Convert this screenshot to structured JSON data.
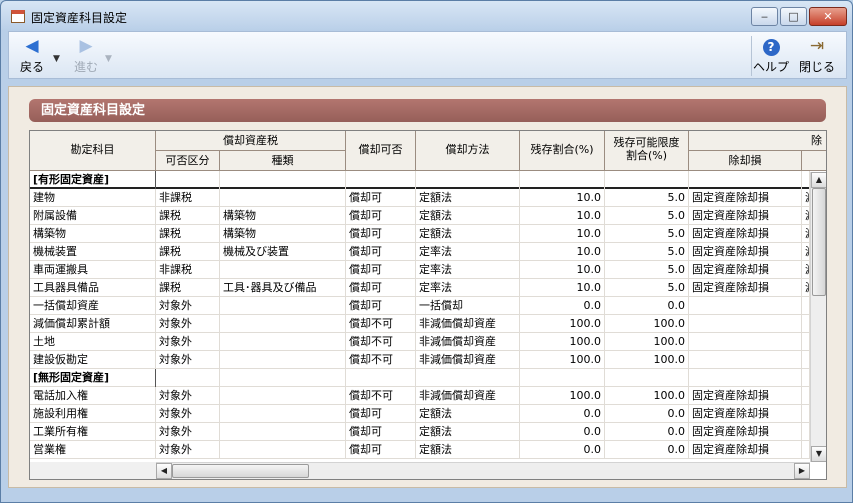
{
  "window": {
    "title": "固定資産科目設定",
    "min": "‒",
    "max": "□",
    "close": "✕"
  },
  "toolbar": {
    "back_label": "戻る",
    "forward_label": "進む",
    "help_label": "ヘルプ",
    "close_label": "閉じる",
    "back_icon": "◀",
    "forward_icon": "▶",
    "help_icon": "?",
    "close_icon": "⇥"
  },
  "section_title": "固定資産科目設定",
  "grid": {
    "headers": {
      "account": "勘定科目",
      "depreciable_tax": "償却資産税",
      "taxable": "可否区分",
      "kind": "種類",
      "depreciable": "償却可否",
      "method": "償却方法",
      "residual": "残存割合(%)",
      "residual_limit_1": "残存可能限度",
      "residual_limit_2": "割合(%)",
      "disposal_group": "除",
      "disposal_loss": "除却損"
    },
    "rows": [
      {
        "type": "category",
        "account": "[有形固定資産]"
      },
      {
        "account": "建物",
        "taxable": "非課税",
        "kind": "",
        "depreciable": "償却可",
        "method": "定額法",
        "residual": "10.0",
        "limit": "5.0",
        "disposal": "固定資産除却損",
        "extra": "減"
      },
      {
        "account": "附属設備",
        "taxable": "課税",
        "kind": "構築物",
        "depreciable": "償却可",
        "method": "定額法",
        "residual": "10.0",
        "limit": "5.0",
        "disposal": "固定資産除却損",
        "extra": "減"
      },
      {
        "account": "構築物",
        "taxable": "課税",
        "kind": "構築物",
        "depreciable": "償却可",
        "method": "定額法",
        "residual": "10.0",
        "limit": "5.0",
        "disposal": "固定資産除却損",
        "extra": "減"
      },
      {
        "account": "機械装置",
        "taxable": "課税",
        "kind": "機械及び装置",
        "depreciable": "償却可",
        "method": "定率法",
        "residual": "10.0",
        "limit": "5.0",
        "disposal": "固定資産除却損",
        "extra": "減"
      },
      {
        "account": "車両運搬具",
        "taxable": "非課税",
        "kind": "",
        "depreciable": "償却可",
        "method": "定率法",
        "residual": "10.0",
        "limit": "5.0",
        "disposal": "固定資産除却損",
        "extra": "減"
      },
      {
        "account": "工具器具備品",
        "taxable": "課税",
        "kind": "工具･器具及び備品",
        "depreciable": "償却可",
        "method": "定率法",
        "residual": "10.0",
        "limit": "5.0",
        "disposal": "固定資産除却損",
        "extra": "減"
      },
      {
        "account": "一括償却資産",
        "taxable": "対象外",
        "kind": "",
        "depreciable": "償却可",
        "method": "一括償却",
        "residual": "0.0",
        "limit": "0.0",
        "disposal": "",
        "extra": ""
      },
      {
        "account": "減価償却累計額",
        "taxable": "対象外",
        "kind": "",
        "depreciable": "償却不可",
        "method": "非減価償却資産",
        "residual": "100.0",
        "limit": "100.0",
        "disposal": "",
        "extra": ""
      },
      {
        "account": "土地",
        "taxable": "対象外",
        "kind": "",
        "depreciable": "償却不可",
        "method": "非減価償却資産",
        "residual": "100.0",
        "limit": "100.0",
        "disposal": "",
        "extra": ""
      },
      {
        "account": "建設仮勘定",
        "taxable": "対象外",
        "kind": "",
        "depreciable": "償却不可",
        "method": "非減価償却資産",
        "residual": "100.0",
        "limit": "100.0",
        "disposal": "",
        "extra": ""
      },
      {
        "type": "category",
        "account": "[無形固定資産]"
      },
      {
        "account": "電話加入権",
        "taxable": "対象外",
        "kind": "",
        "depreciable": "償却不可",
        "method": "非減価償却資産",
        "residual": "100.0",
        "limit": "100.0",
        "disposal": "固定資産除却損",
        "extra": ""
      },
      {
        "account": "施設利用権",
        "taxable": "対象外",
        "kind": "",
        "depreciable": "償却可",
        "method": "定額法",
        "residual": "0.0",
        "limit": "0.0",
        "disposal": "固定資産除却損",
        "extra": ""
      },
      {
        "account": "工業所有権",
        "taxable": "対象外",
        "kind": "",
        "depreciable": "償却可",
        "method": "定額法",
        "residual": "0.0",
        "limit": "0.0",
        "disposal": "固定資産除却損",
        "extra": ""
      },
      {
        "account": "営業権",
        "taxable": "対象外",
        "kind": "",
        "depreciable": "償却可",
        "method": "定額法",
        "residual": "0.0",
        "limit": "0.0",
        "disposal": "固定資産除却損",
        "extra": ""
      }
    ]
  },
  "scroll": {
    "up": "▲",
    "down": "▼",
    "left": "◀",
    "right": "▶"
  }
}
